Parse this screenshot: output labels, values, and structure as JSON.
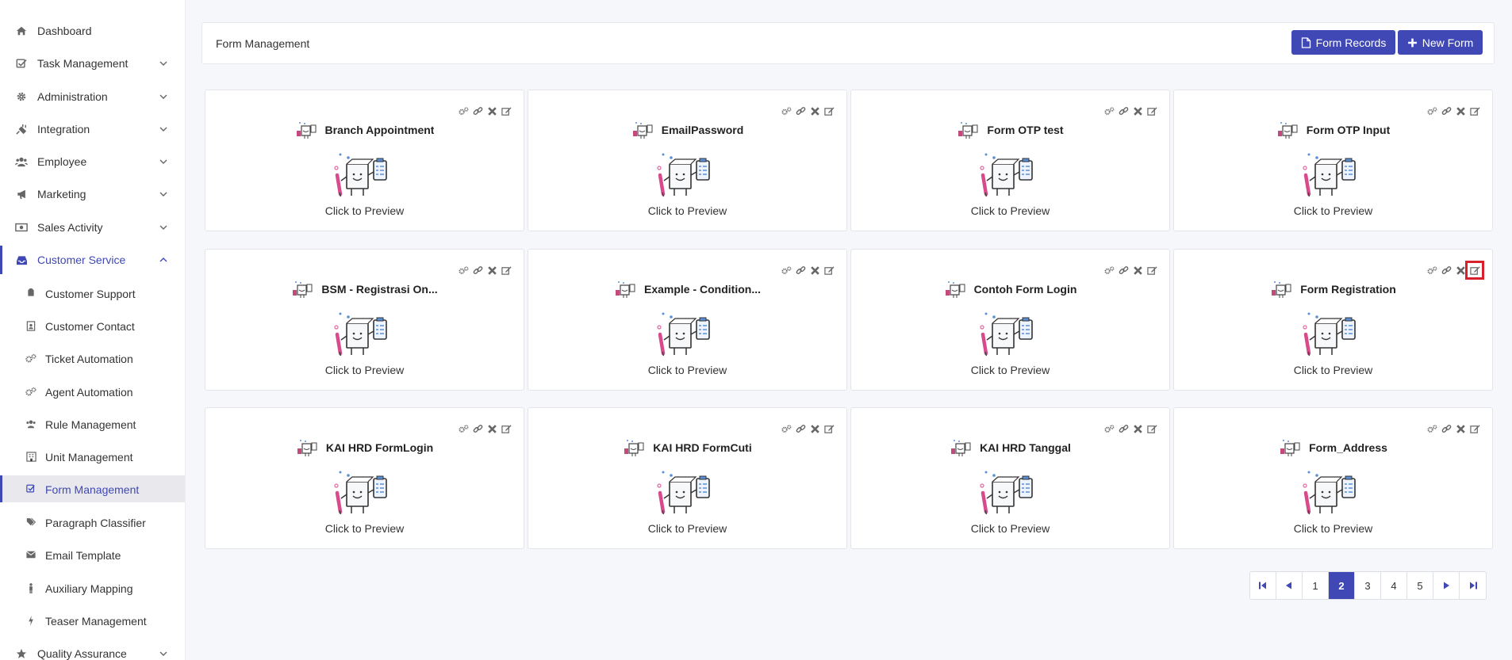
{
  "sidebar": {
    "items": [
      {
        "label": "Dashboard",
        "icon": "home-icon"
      },
      {
        "label": "Task Management",
        "icon": "check-square-icon"
      },
      {
        "label": "Administration",
        "icon": "gear-icon"
      },
      {
        "label": "Integration",
        "icon": "plug-icon"
      },
      {
        "label": "Employee",
        "icon": "users-icon"
      },
      {
        "label": "Marketing",
        "icon": "bullhorn-icon"
      },
      {
        "label": "Sales Activity",
        "icon": "money-icon"
      },
      {
        "label": "Customer Service",
        "icon": "inbox-icon"
      }
    ],
    "subitems": [
      {
        "label": "Customer Support",
        "icon": "tag-icon"
      },
      {
        "label": "Customer Contact",
        "icon": "contact-icon"
      },
      {
        "label": "Ticket Automation",
        "icon": "cogs-icon"
      },
      {
        "label": "Agent Automation",
        "icon": "cogs-icon"
      },
      {
        "label": "Rule Management",
        "icon": "users-icon"
      },
      {
        "label": "Unit Management",
        "icon": "building-icon"
      },
      {
        "label": "Form Management",
        "icon": "check-square-icon"
      },
      {
        "label": "Paragraph Classifier",
        "icon": "tags-icon"
      },
      {
        "label": "Email Template",
        "icon": "envelope-icon"
      },
      {
        "label": "Auxiliary Mapping",
        "icon": "person-icon"
      },
      {
        "label": "Teaser Management",
        "icon": "bolt-icon"
      }
    ],
    "last_item": {
      "label": "Quality Assurance",
      "icon": "star-icon"
    }
  },
  "header": {
    "title": "Form Management",
    "records_label": "Form Records",
    "new_label": "New Form"
  },
  "cards": [
    {
      "title": "Branch Appointment",
      "preview": "Click to Preview"
    },
    {
      "title": "EmailPassword",
      "preview": "Click to Preview"
    },
    {
      "title": "Form OTP test",
      "preview": "Click to Preview"
    },
    {
      "title": "Form OTP Input",
      "preview": "Click to Preview"
    },
    {
      "title": "BSM - Registrasi On...",
      "preview": "Click to Preview"
    },
    {
      "title": "Example - Condition...",
      "preview": "Click to Preview"
    },
    {
      "title": "Contoh Form Login",
      "preview": "Click to Preview"
    },
    {
      "title": "Form Registration",
      "preview": "Click to Preview"
    },
    {
      "title": "KAI HRD FormLogin",
      "preview": "Click to Preview"
    },
    {
      "title": "KAI HRD FormCuti",
      "preview": "Click to Preview"
    },
    {
      "title": "KAI HRD Tanggal",
      "preview": "Click to Preview"
    },
    {
      "title": "Form_Address",
      "preview": "Click to Preview"
    }
  ],
  "pagination": {
    "pages": [
      "1",
      "2",
      "3",
      "4",
      "5"
    ],
    "current": "2"
  },
  "colors": {
    "accent": "#3f48b5",
    "highlight": "#d8202a"
  }
}
